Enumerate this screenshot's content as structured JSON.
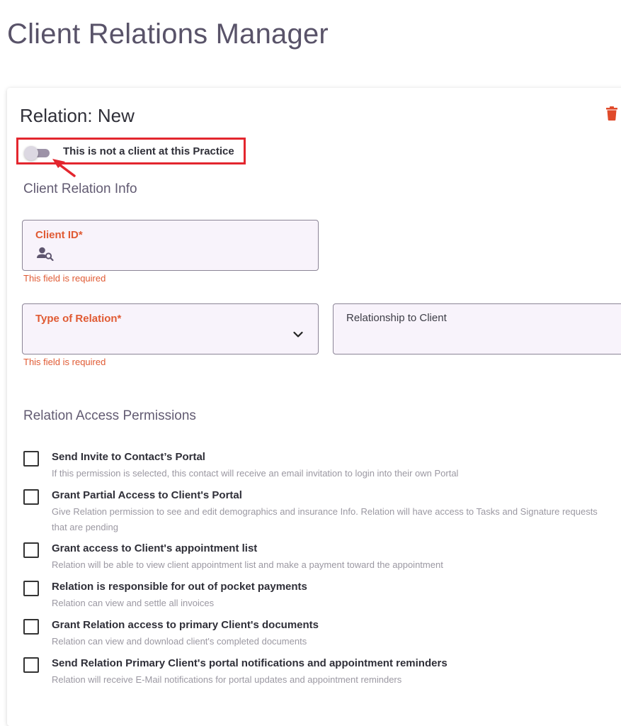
{
  "page": {
    "title": "Client Relations Manager"
  },
  "relation": {
    "title": "Relation: New",
    "not_client_toggle": {
      "label": "This is not a client at this Practice",
      "on": false
    }
  },
  "client_info": {
    "heading": "Client Relation Info",
    "client_id": {
      "label": "Client ID*",
      "value": "",
      "error": "This field is required"
    },
    "type_of_relation": {
      "label": "Type of Relation*",
      "value": "",
      "error": "This field is required"
    },
    "relationship_to_client": {
      "label": "Relationship to Client",
      "value": ""
    }
  },
  "permissions": {
    "heading": "Relation Access Permissions",
    "items": [
      {
        "title": "Send Invite to Contact’s Portal",
        "description": "If this permission is selected, this contact will receive an email invitation to login into their own Portal",
        "checked": false
      },
      {
        "title": "Grant Partial Access to Client's Portal",
        "description": "Give Relation permission to see and edit demographics and insurance Info. Relation will have access to Tasks and Signature requests that are pending",
        "checked": false
      },
      {
        "title": "Grant access to Client's appointment list",
        "description": "Relation will be able to view client appointment list and make a payment toward the appointment",
        "checked": false
      },
      {
        "title": "Relation is responsible for out of pocket payments",
        "description": "Relation can view and settle all invoices",
        "checked": false
      },
      {
        "title": "Grant Relation access to primary Client's documents",
        "description": "Relation can view and download client's completed documents",
        "checked": false
      },
      {
        "title": "Send Relation Primary Client's portal notifications and appointment reminders",
        "description": "Relation will receive E-Mail notifications for portal updates and appointment reminders",
        "checked": false
      }
    ]
  },
  "colors": {
    "error": "#e05a33",
    "highlight": "#e3262e",
    "field_bg": "#f8f3fb",
    "delete": "#e04a2a"
  }
}
